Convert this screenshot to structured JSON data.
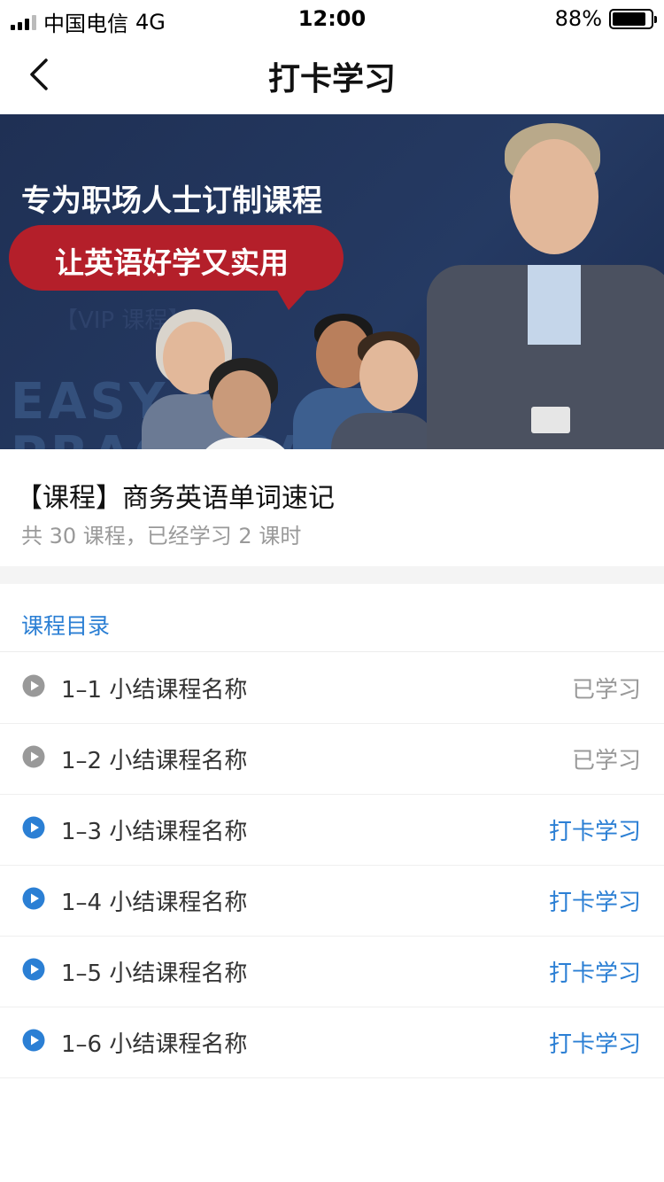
{
  "status_bar": {
    "carrier": "中国电信",
    "network": "4G",
    "time": "12:00",
    "battery_text": "88%",
    "battery_level": 0.88
  },
  "nav": {
    "title": "打卡学习",
    "back_icon": "chevron-left-icon"
  },
  "banner": {
    "headline": "专为职场人士订制课程",
    "ribbon": "让英语好学又实用",
    "vip_tag": "【VIP 课程】",
    "watermark_line1": "EASY &",
    "watermark_line2": "PRACTICAL",
    "ribbon_color": "#b41f2a",
    "background_color": "#1f3054"
  },
  "course": {
    "title": "【课程】商务英语单词速记",
    "meta": "共 30 课程，已经学习 2 课时"
  },
  "catalog": {
    "header": "课程目录",
    "accent_color": "#2b7fd4",
    "lessons": [
      {
        "name": "1–1 小结课程名称",
        "status": "已学习",
        "done": true,
        "icon": "play-circle-icon"
      },
      {
        "name": "1–2 小结课程名称",
        "status": "已学习",
        "done": true,
        "icon": "play-circle-icon"
      },
      {
        "name": "1–3 小结课程名称",
        "status": "打卡学习",
        "done": false,
        "icon": "play-circle-icon"
      },
      {
        "name": "1–4 小结课程名称",
        "status": "打卡学习",
        "done": false,
        "icon": "play-circle-icon"
      },
      {
        "name": "1–5 小结课程名称",
        "status": "打卡学习",
        "done": false,
        "icon": "play-circle-icon"
      },
      {
        "name": "1–6 小结课程名称",
        "status": "打卡学习",
        "done": false,
        "icon": "play-circle-icon"
      }
    ]
  }
}
